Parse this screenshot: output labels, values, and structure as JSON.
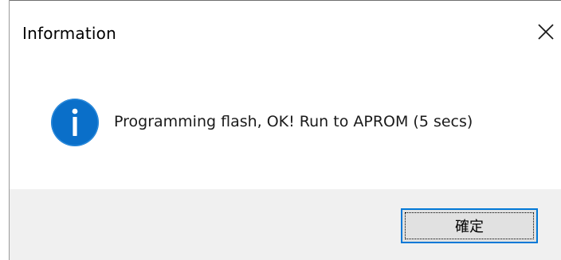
{
  "window": {
    "title": "Information",
    "close_icon": "close-icon"
  },
  "message": {
    "icon": "info-icon",
    "text": "Programming flash, OK! Run to APROM (5 secs)"
  },
  "buttons": {
    "ok_label": "確定"
  },
  "colors": {
    "info_blue": "#0a6fc9",
    "focus_border": "#0078d7",
    "footer_bg": "#f0f0f0",
    "button_bg": "#e1e1e1"
  }
}
